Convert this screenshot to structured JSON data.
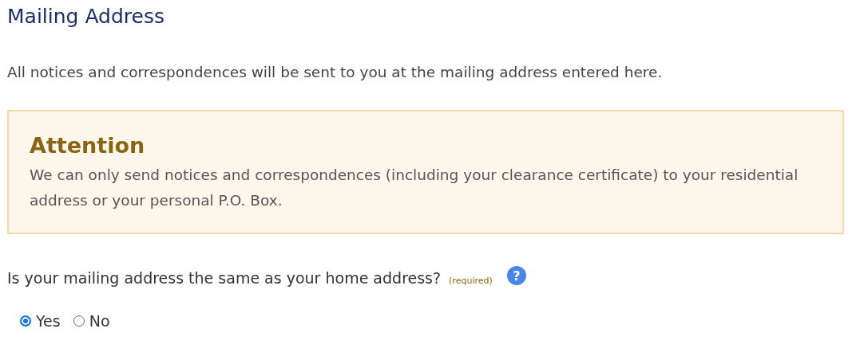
{
  "heading": "Mailing Address",
  "intro": "All notices and correspondences will be sent to you at the mailing address entered here.",
  "attention": {
    "title": "Attention",
    "body": "We can only send notices and correspondences (including your clearance certificate) to your residential address or your personal P.O. Box."
  },
  "question": {
    "label": "Is your mailing address the same as your home address?",
    "required": "(required)",
    "help": "?",
    "options": [
      {
        "label": "Yes",
        "selected": true
      },
      {
        "label": "No",
        "selected": false
      }
    ]
  }
}
